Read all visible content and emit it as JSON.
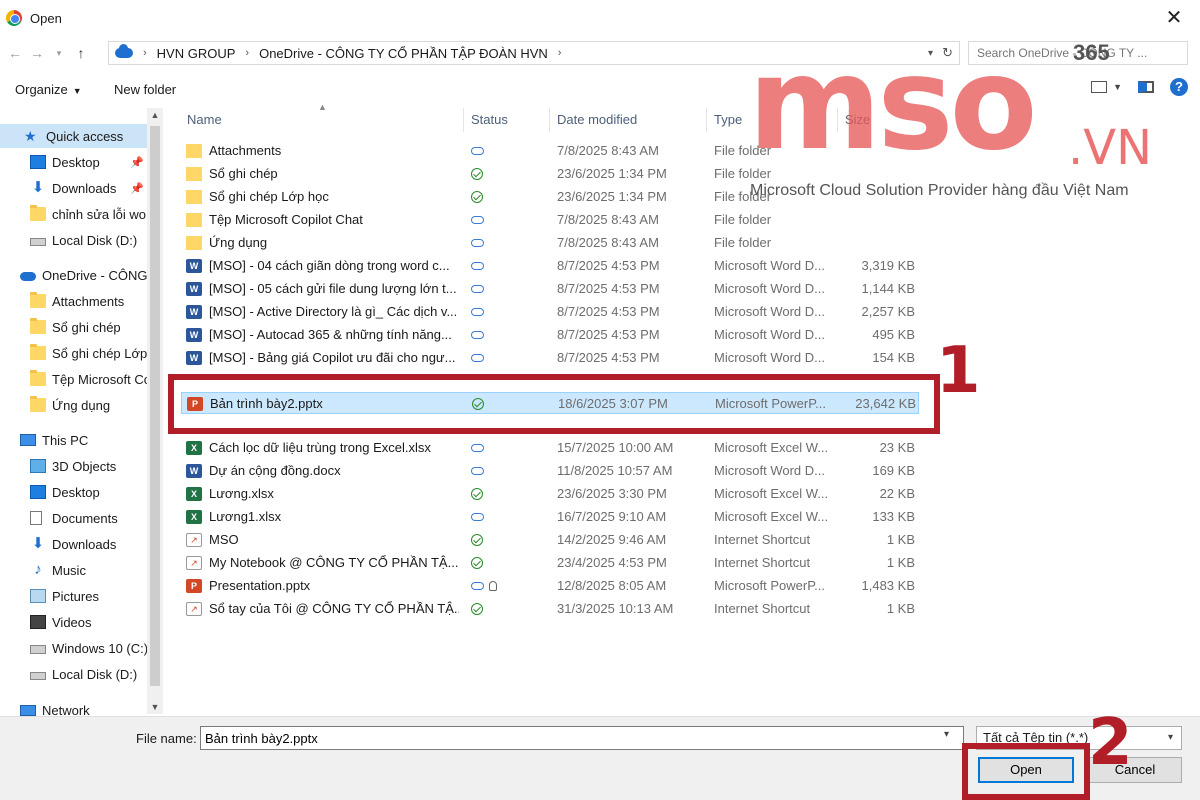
{
  "window": {
    "title": "Open",
    "close_glyph": "✕"
  },
  "address": {
    "crumbs": [
      "HVN GROUP",
      "OneDrive - CÔNG TY CỔ PHẦN TẬP ĐOÀN HVN"
    ],
    "search_placeholder": "Search OneDrive - CÔNG TY ..."
  },
  "toolbar": {
    "organize": "Organize",
    "new_folder": "New folder"
  },
  "nav": {
    "quick_access": "Quick access",
    "desktop": "Desktop",
    "downloads": "Downloads",
    "chinh_sua": "chỉnh sửa lỗi wo",
    "local_disk_d": "Local Disk (D:)",
    "onedrive": "OneDrive - CÔNG",
    "attachments": "Attachments",
    "so_ghi_chep": "Sổ ghi chép",
    "so_ghi_chep_lop": "Sổ ghi chép Lớp",
    "tep_copilot": "Tệp Microsoft Co",
    "ung_dung": "Ứng dụng",
    "this_pc": "This PC",
    "objects_3d": "3D Objects",
    "pc_desktop": "Desktop",
    "documents": "Documents",
    "pc_downloads": "Downloads",
    "music": "Music",
    "pictures": "Pictures",
    "videos": "Videos",
    "windows_c": "Windows 10 (C:)",
    "pc_local_d": "Local Disk (D:)",
    "network": "Network"
  },
  "columns": {
    "name": "Name",
    "status": "Status",
    "date": "Date modified",
    "type": "Type",
    "size": "Size"
  },
  "files": [
    {
      "name": "Attachments",
      "status": "cloud",
      "date": "7/8/2025 8:43 AM",
      "type": "File folder",
      "size": ""
    },
    {
      "name": "Sổ ghi chép",
      "status": "ok",
      "date": "23/6/2025 1:34 PM",
      "type": "File folder",
      "size": ""
    },
    {
      "name": "Sổ ghi chép Lớp học",
      "status": "ok",
      "date": "23/6/2025 1:34 PM",
      "type": "File folder",
      "size": ""
    },
    {
      "name": "Tệp Microsoft Copilot Chat",
      "status": "cloud",
      "date": "7/8/2025 8:43 AM",
      "type": "File folder",
      "size": ""
    },
    {
      "name": "Ứng dụng",
      "status": "cloud",
      "date": "7/8/2025 8:43 AM",
      "type": "File folder",
      "size": ""
    },
    {
      "name": "[MSO] - 04 cách giãn dòng trong word c...",
      "status": "cloud",
      "date": "8/7/2025 4:53 PM",
      "type": "Microsoft Word D...",
      "size": "3,319 KB"
    },
    {
      "name": "[MSO] - 05 cách gửi file dung lượng lớn t...",
      "status": "cloud",
      "date": "8/7/2025 4:53 PM",
      "type": "Microsoft Word D...",
      "size": "1,144 KB"
    },
    {
      "name": "[MSO] - Active Directory là gì_ Các dịch v...",
      "status": "cloud",
      "date": "8/7/2025 4:53 PM",
      "type": "Microsoft Word D...",
      "size": "2,257 KB"
    },
    {
      "name": "[MSO] - Autocad 365 & những tính năng...",
      "status": "cloud",
      "date": "8/7/2025 4:53 PM",
      "type": "Microsoft Word D...",
      "size": "495 KB"
    },
    {
      "name": "[MSO] - Bảng giá Copilot ưu đãi cho ngư...",
      "status": "cloud",
      "date": "8/7/2025 4:53 PM",
      "type": "Microsoft Word D...",
      "size": "154 KB"
    },
    {
      "name": "Bản trình bày2.pptx",
      "status": "ok",
      "date": "18/6/2025 3:07 PM",
      "type": "Microsoft PowerP...",
      "size": "23,642 KB"
    },
    {
      "name": "Cách lọc dữ liệu trùng trong Excel.xlsx",
      "status": "cloud",
      "date": "15/7/2025 10:00 AM",
      "type": "Microsoft Excel W...",
      "size": "23 KB"
    },
    {
      "name": "Dự án cộng đồng.docx",
      "status": "cloud",
      "date": "11/8/2025 10:57 AM",
      "type": "Microsoft Word D...",
      "size": "169 KB"
    },
    {
      "name": "Lương.xlsx",
      "status": "ok",
      "date": "23/6/2025 3:30 PM",
      "type": "Microsoft Excel W...",
      "size": "22 KB"
    },
    {
      "name": "Lương1.xlsx",
      "status": "cloud",
      "date": "16/7/2025 9:10 AM",
      "type": "Microsoft Excel W...",
      "size": "133 KB"
    },
    {
      "name": "MSO",
      "status": "ok",
      "date": "14/2/2025 9:46 AM",
      "type": "Internet Shortcut",
      "size": "1 KB"
    },
    {
      "name": "My Notebook @ CÔNG TY CỔ PHẦN TẬ...",
      "status": "ok",
      "date": "23/4/2025 4:53 PM",
      "type": "Internet Shortcut",
      "size": "1 KB"
    },
    {
      "name": "Presentation.pptx",
      "status": "cloud-shared",
      "date": "12/8/2025 8:05 AM",
      "type": "Microsoft PowerP...",
      "size": "1,483 KB"
    },
    {
      "name": "Sổ tay của Tôi @ CÔNG TY CỔ PHẦN TẬ...",
      "status": "ok",
      "date": "31/3/2025 10:13 AM",
      "type": "Internet Shortcut",
      "size": "1 KB"
    }
  ],
  "footer": {
    "file_name_label": "File name:",
    "file_name_value": "Bản trình bày2.pptx",
    "file_type": "Tất cả Tệp tin (*.*)",
    "open": "Open",
    "cancel": "Cancel"
  },
  "annotations": {
    "step1": "1",
    "step2": "2",
    "color": "#b21e28"
  },
  "watermark": {
    "brand": "mso",
    "suffix": ".VN",
    "badge": "365",
    "tagline": "Microsoft Cloud Solution Provider hàng đầu Việt Nam"
  }
}
